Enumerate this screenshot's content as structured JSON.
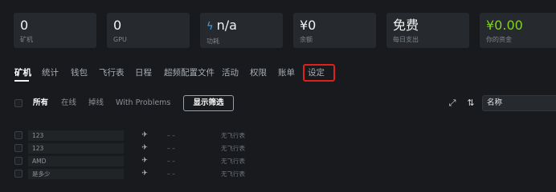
{
  "stats": [
    {
      "value": "0",
      "label": "矿机"
    },
    {
      "value": "0",
      "label": "GPU"
    },
    {
      "value": "n/a",
      "label": "功耗",
      "icon": "lightning-icon"
    },
    {
      "value": "¥0",
      "label": "余额"
    },
    {
      "value": "免费",
      "label": "每日支出"
    },
    {
      "value": "¥0.00",
      "label": "你的资金",
      "color": "#7ed321"
    }
  ],
  "tabs": [
    {
      "label": "矿机",
      "active": true
    },
    {
      "label": "统计"
    },
    {
      "label": "钱包"
    },
    {
      "label": "飞行表"
    },
    {
      "label": "日程"
    },
    {
      "label": "超频配置文件"
    },
    {
      "label": "活动"
    },
    {
      "label": "权限"
    },
    {
      "label": "账单"
    },
    {
      "label": "设定",
      "highlighted": true
    }
  ],
  "filters": {
    "items": [
      "所有",
      "在线",
      "掉线",
      "With Problems"
    ],
    "active": "所有",
    "show_filter_label": "显示筛选",
    "sort_value": "名称",
    "expand_icon": "expand-icon",
    "sort_icon": "sort-icon"
  },
  "rigs": [
    {
      "name": "123",
      "dash": "– –",
      "flight_sheet": "无飞行表"
    },
    {
      "name": "123",
      "dash": "– –",
      "flight_sheet": "无飞行表"
    },
    {
      "name": "AMD",
      "dash": "– –",
      "flight_sheet": "无飞行表"
    },
    {
      "name": "是多少",
      "dash": "– –",
      "flight_sheet": "无飞行表"
    }
  ],
  "colors": {
    "accent_green": "#7ed321",
    "bolt_blue": "#3fa3f0",
    "highlight_red": "#e0201b"
  }
}
